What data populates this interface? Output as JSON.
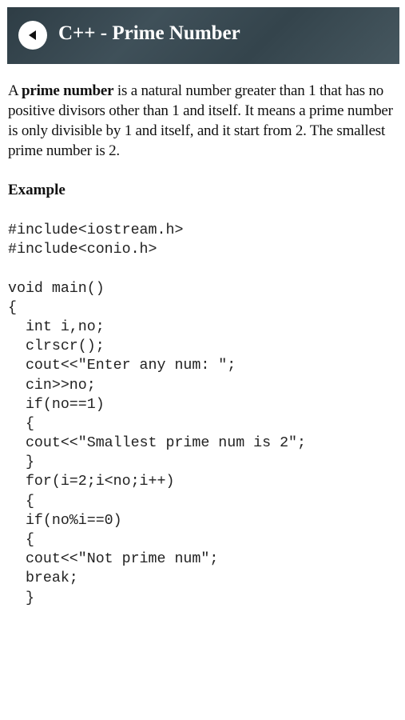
{
  "header": {
    "back_icon": "back-arrow-icon",
    "title": "C++ - Prime Number"
  },
  "intro": {
    "lead": "A ",
    "term": "prime number",
    "text": " is a natural number greater than 1 that has no positive divisors other than 1 and itself. It means a prime number is only divisible by 1 and itself, and it start from 2. The smallest prime number is 2."
  },
  "example_heading": "Example",
  "code_lines": [
    "#include<iostream.h>",
    "#include<conio.h>",
    "",
    "void main()",
    "{",
    "  int i,no;",
    "  clrscr();",
    "  cout<<\"Enter any num: \";",
    "  cin>>no;",
    "  if(no==1)",
    "  {",
    "  cout<<\"Smallest prime num is 2\";",
    "  }",
    "  for(i=2;i<no;i++)",
    "  {",
    "  if(no%i==0)",
    "  {",
    "  cout<<\"Not prime num\";",
    "  break;",
    "  }"
  ],
  "colors": {
    "header_bg": "#3a4a52",
    "header_text": "#ffffff",
    "body_text": "#111111"
  }
}
